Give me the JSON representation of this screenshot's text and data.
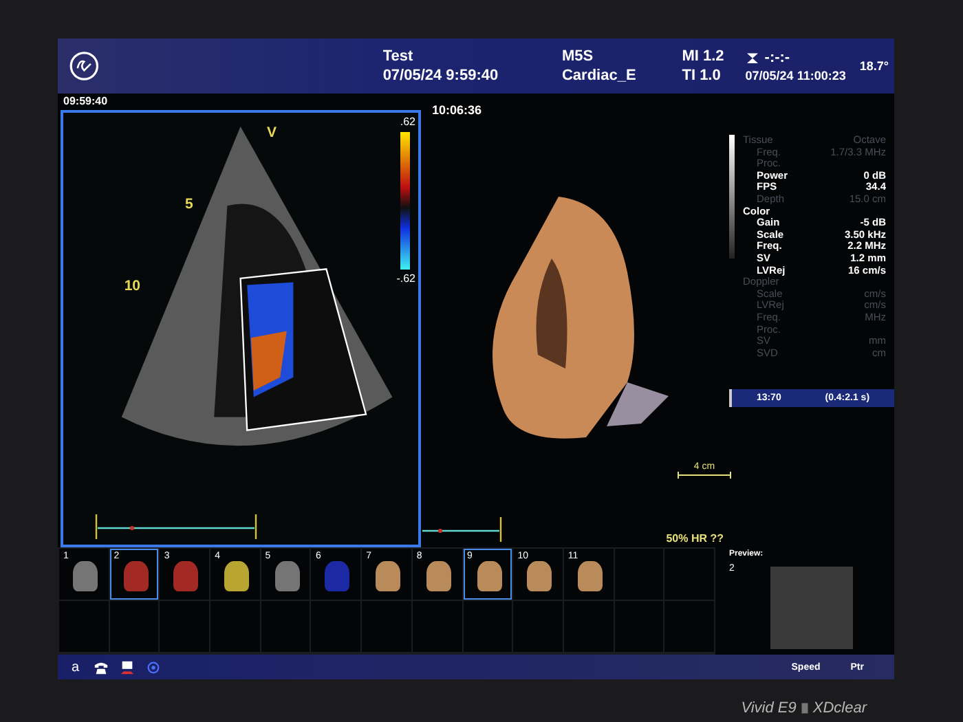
{
  "header": {
    "patient": "Test",
    "exam_datetime": "07/05/24 9:59:40",
    "probe": "M5S",
    "preset": "Cardiac_E",
    "mi": "MI 1.2",
    "ti": "TI 1.0",
    "timer": "-:-:-",
    "current_datetime": "07/05/24 11:00:23",
    "temperature": "18.7°"
  },
  "left_image": {
    "timestamp": "09:59:40",
    "orientation_mark": "V",
    "depth_marks": [
      "5",
      "10"
    ],
    "scale_top": ".62",
    "scale_bottom": "-.62"
  },
  "middle": {
    "timestamp": "10:06:36",
    "scale_bar": "4 cm",
    "hr_note": "50% HR ??"
  },
  "parameters": [
    {
      "kind": "heading",
      "label": "Tissue",
      "value": "Octave",
      "active": false
    },
    {
      "kind": "param",
      "label": "Freq.",
      "value": "1.7/3.3 MHz",
      "active": false
    },
    {
      "kind": "param",
      "label": "Proc.",
      "active": false
    },
    {
      "kind": "param",
      "label": "Power",
      "value": "0 dB",
      "active": true
    },
    {
      "kind": "param",
      "label": "FPS",
      "value": "34.4",
      "active": true
    },
    {
      "kind": "param",
      "label": "Depth",
      "value": "15.0 cm",
      "active": false
    },
    {
      "kind": "heading",
      "label": "Color",
      "active": true
    },
    {
      "kind": "param",
      "label": "Gain",
      "value": "-5 dB",
      "active": true
    },
    {
      "kind": "param",
      "label": "Scale",
      "value": "3.50 kHz",
      "active": true
    },
    {
      "kind": "param",
      "label": "Freq.",
      "value": "2.2 MHz",
      "active": true
    },
    {
      "kind": "param",
      "label": "SV",
      "value": "1.2 mm",
      "active": true
    },
    {
      "kind": "param",
      "label": "LVRej",
      "value": "16 cm/s",
      "active": true
    },
    {
      "kind": "heading",
      "label": "Doppler",
      "active": false
    },
    {
      "kind": "param",
      "label": "Scale",
      "value": "cm/s",
      "active": false
    },
    {
      "kind": "param",
      "label": "LVRej",
      "value": "cm/s",
      "active": false
    },
    {
      "kind": "param",
      "label": "Freq.",
      "value": "MHz",
      "active": false
    },
    {
      "kind": "param",
      "label": "Proc.",
      "active": false
    },
    {
      "kind": "param",
      "label": "SV",
      "value": "mm",
      "active": false
    },
    {
      "kind": "param",
      "label": "SVD",
      "value": "cm",
      "active": false
    }
  ],
  "timeline": {
    "value": "13:70",
    "range": "(0.4:2.1 s)"
  },
  "preview": {
    "label": "Preview:",
    "number": "2"
  },
  "thumbnails": [
    {
      "number": "1",
      "kind": "grayscale",
      "selected": false
    },
    {
      "number": "2",
      "kind": "color",
      "selected": true
    },
    {
      "number": "3",
      "kind": "color",
      "selected": false
    },
    {
      "number": "4",
      "kind": "trace",
      "selected": false
    },
    {
      "number": "5",
      "kind": "grayscale",
      "selected": false
    },
    {
      "number": "6",
      "kind": "model",
      "selected": false
    },
    {
      "number": "7",
      "kind": "volume",
      "selected": false
    },
    {
      "number": "8",
      "kind": "volume",
      "selected": false
    },
    {
      "number": "9",
      "kind": "volume",
      "selected": true
    },
    {
      "number": "10",
      "kind": "volume",
      "selected": false
    },
    {
      "number": "11",
      "kind": "volume",
      "selected": false
    }
  ],
  "bottom_bar": {
    "key": "a",
    "labels": [
      "Speed",
      "Ptr"
    ]
  },
  "device_label": {
    "model": "Vivid E9",
    "suffix": "XDclear"
  }
}
